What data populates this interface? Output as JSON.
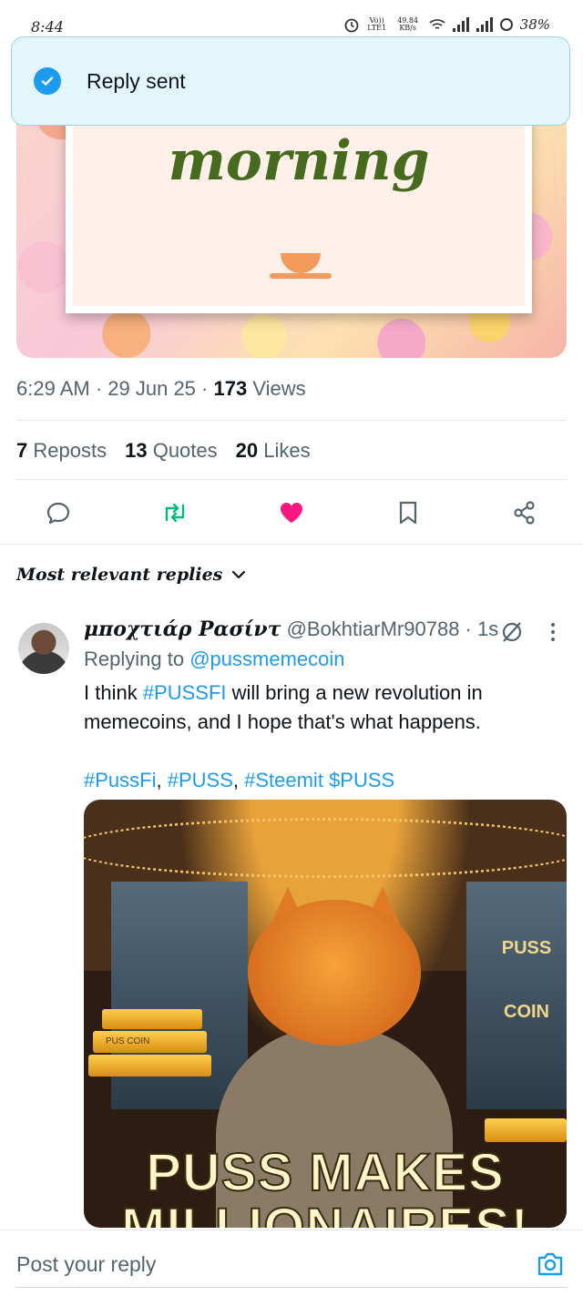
{
  "status": {
    "time": "8:44",
    "volte": "Vo)) LTE1",
    "speed": "49.84 KB/s",
    "battery": "38%"
  },
  "toast": {
    "text": "Reply sent"
  },
  "post": {
    "image_text": "morning",
    "time": "6:29 AM",
    "date": "29 Jun 25",
    "views_count": "173",
    "views_label": "Views",
    "reposts_count": "7",
    "reposts_label": "Reposts",
    "quotes_count": "13",
    "quotes_label": "Quotes",
    "likes_count": "20",
    "likes_label": "Likes"
  },
  "sort": {
    "label": "Most relevant replies"
  },
  "reply": {
    "name": "μποχτιάρ Ρασίντ",
    "handle": "@BokhtiarMr90788",
    "time": "1s",
    "replying_prefix": "Replying to",
    "replying_to": "@pussmemecoin",
    "text_1": "I think ",
    "tag_1": "#PUSSFI",
    "text_2": " will bring a new revolution in memecoins, and I hope that's what happens.",
    "tag_2": "#PussFi",
    "tag_3": "#PUSS",
    "tag_4": "#Steemit",
    "tag_5": "$PUSS",
    "image": {
      "caption_line1": "PUSS MAKES",
      "caption_line2": "MILLIONAIRES!",
      "bar_label": "PUS COIN",
      "sign_top": "PUSS",
      "sign_bottom": "COIN"
    }
  },
  "compose": {
    "placeholder": "Post your reply"
  },
  "colors": {
    "accent": "#1d9bf0",
    "retweet": "#00ba7c",
    "like": "#f91880",
    "text": "#0f1419",
    "muted": "#536471"
  }
}
